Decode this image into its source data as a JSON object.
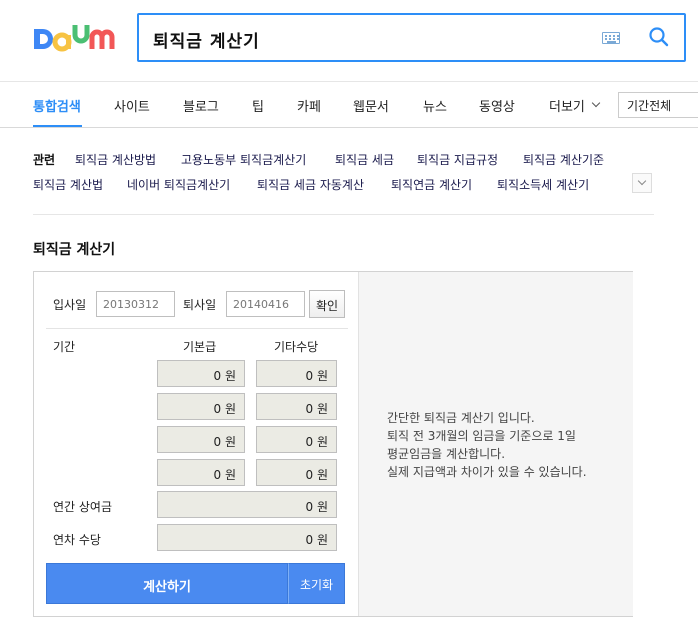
{
  "brand": {
    "name": "Daum",
    "colors": {
      "d": "#3e87f5",
      "a": "#f7c343",
      "u": "#4bbf73",
      "m": "#f25757"
    }
  },
  "search": {
    "query": "퇴직금 계산기",
    "keyboard_icon": "keyboard-icon",
    "search_icon": "search-icon"
  },
  "tabs": [
    {
      "label": "통합검색",
      "active": true
    },
    {
      "label": "사이트"
    },
    {
      "label": "블로그"
    },
    {
      "label": "팁"
    },
    {
      "label": "카페"
    },
    {
      "label": "웹문서"
    },
    {
      "label": "뉴스"
    },
    {
      "label": "동영상"
    },
    {
      "label": "더보기"
    }
  ],
  "period_filter": "기간전체",
  "related": {
    "title": "관련",
    "row1": [
      "퇴직금 계산방법",
      "고용노동부 퇴직금계산기",
      "퇴직금 세금",
      "퇴직금 지급규정",
      "퇴직금 계산기준"
    ],
    "row2": [
      "퇴직금 계산법",
      "네이버 퇴직금계산기",
      "퇴직금 세금 자동계산",
      "퇴직연금 계산기",
      "퇴직소득세 계산기"
    ]
  },
  "calculator": {
    "title": "퇴직금 계산기",
    "start_label": "입사일",
    "start_placeholder": "20130312",
    "end_label": "퇴사일",
    "end_placeholder": "20140416",
    "confirm": "확인",
    "period_col": "기간",
    "base_pay_col": "기본급",
    "other_pay_col": "기타수당",
    "month_rows": [
      {
        "base": "0 원",
        "other": "0 원"
      },
      {
        "base": "0 원",
        "other": "0 원"
      },
      {
        "base": "0 원",
        "other": "0 원"
      },
      {
        "base": "0 원",
        "other": "0 원"
      }
    ],
    "annual_bonus_label": "연간 상여금",
    "annual_bonus_value": "0 원",
    "annual_leave_label": "연차 수당",
    "annual_leave_value": "0 원",
    "calculate": "계산하기",
    "reset": "초기화",
    "info_lines": [
      "간단한 퇴직금 계산기 입니다.",
      "퇴직 전 3개월의 임금을 기준으로 1일",
      "평균임금을 계산합니다.",
      "실제 지급액과 차이가 있을 수 있습니다."
    ]
  }
}
